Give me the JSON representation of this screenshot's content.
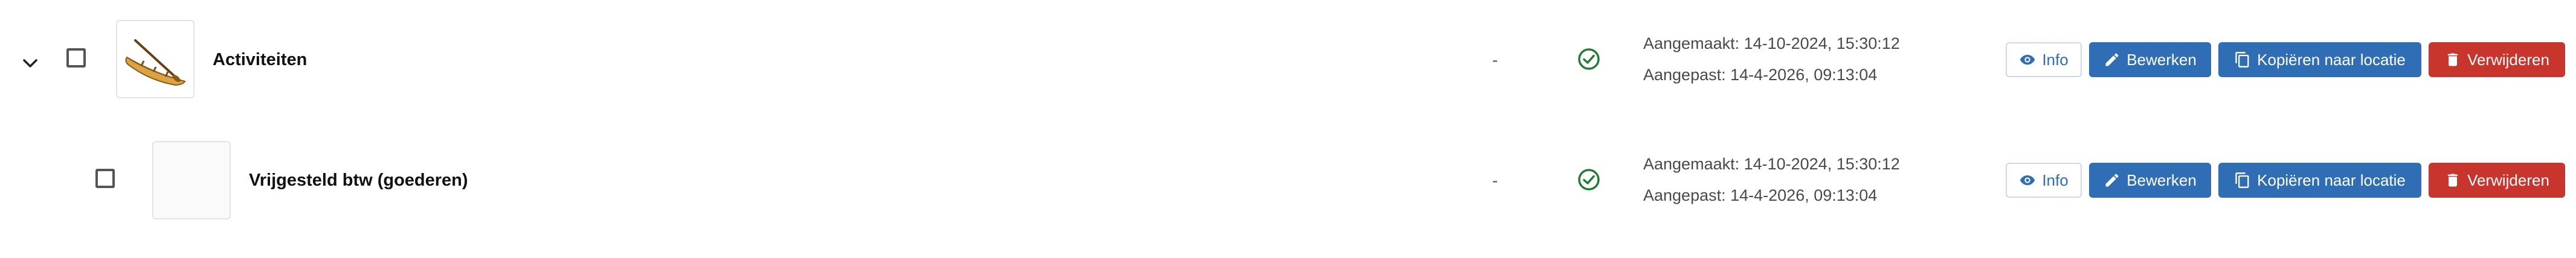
{
  "rows": [
    {
      "name": "Activiteiten",
      "expandable": true,
      "has_image": true,
      "image_icon": "canoe-image",
      "value": "-",
      "status_icon": "check-circle-icon",
      "created": "Aangemaakt: 14-10-2024, 15:30:12",
      "modified": "Aangepast: 14-4-2026, 09:13:04"
    },
    {
      "name": "Vrijgesteld btw (goederen)",
      "expandable": false,
      "has_image": false,
      "value": "-",
      "status_icon": "check-circle-icon",
      "created": "Aangemaakt: 14-10-2024, 15:30:12",
      "modified": "Aangepast: 14-4-2026, 09:13:04"
    }
  ],
  "actions": {
    "info": "Info",
    "edit": "Bewerken",
    "copy": "Kopiëren naar locatie",
    "delete": "Verwijderen"
  },
  "colors": {
    "primary": "#2f6db5",
    "danger": "#c7352d",
    "success": "#1e7e34"
  }
}
